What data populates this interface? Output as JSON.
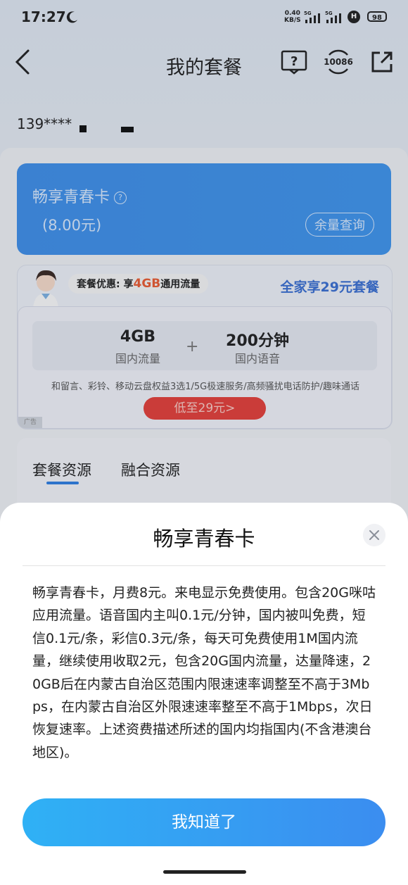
{
  "status_bar": {
    "time": "17:27",
    "net_speed_value": "0.40",
    "net_speed_unit": "KB/S",
    "signal_label": "5G",
    "hd_label": "H",
    "battery": "98"
  },
  "header": {
    "title": "我的套餐",
    "hotline": "10086"
  },
  "account": {
    "phone_masked": "139****"
  },
  "plan_card": {
    "name": "畅享青春卡",
    "fee": "(8.00元)",
    "balance_label": "余量查询"
  },
  "promo": {
    "tag_prefix": "套餐优惠: 享",
    "tag_highlight": "4GB",
    "tag_suffix": "通用流量",
    "family_link": "全家享29元套餐",
    "data_value": "4GB",
    "data_label": "国内流量",
    "plus": "+",
    "voice_value": "200分钟",
    "voice_label": "国内语音",
    "benefits": "和留言、彩铃、移动云盘权益3选1/5G极速服务/高频骚扰电话防护/趣味通话",
    "price_button": "低至29元>",
    "ad_tag": "广告"
  },
  "tabs": [
    {
      "label": "套餐资源",
      "active": true
    },
    {
      "label": "融合资源",
      "active": false
    }
  ],
  "sheet": {
    "title": "畅享青春卡",
    "body": "畅享青春卡，月费8元。来电显示免费使用。包含20G咪咕应用流量。语音国内主叫0.1元/分钟，国内被叫免费，短信0.1元/条，彩信0.3元/条，每天可免费使用1M国内流量，继续使用收取2元，包含20G国内流量，达量降速，20GB后在内蒙古自治区范围内限速速率调整至不高于3Mbps，在内蒙古自治区外限速速率整至不高于1Mbps，次日恢复速率。上述资费描述所述的国内均指国内(不含港澳台地区)。",
    "ok_label": "我知道了"
  },
  "colors": {
    "accent_blue": "#3b8df0",
    "plan_card": "#3f8ee6",
    "promo_red": "#e23f3a",
    "highlight_orange": "#e85a32"
  }
}
